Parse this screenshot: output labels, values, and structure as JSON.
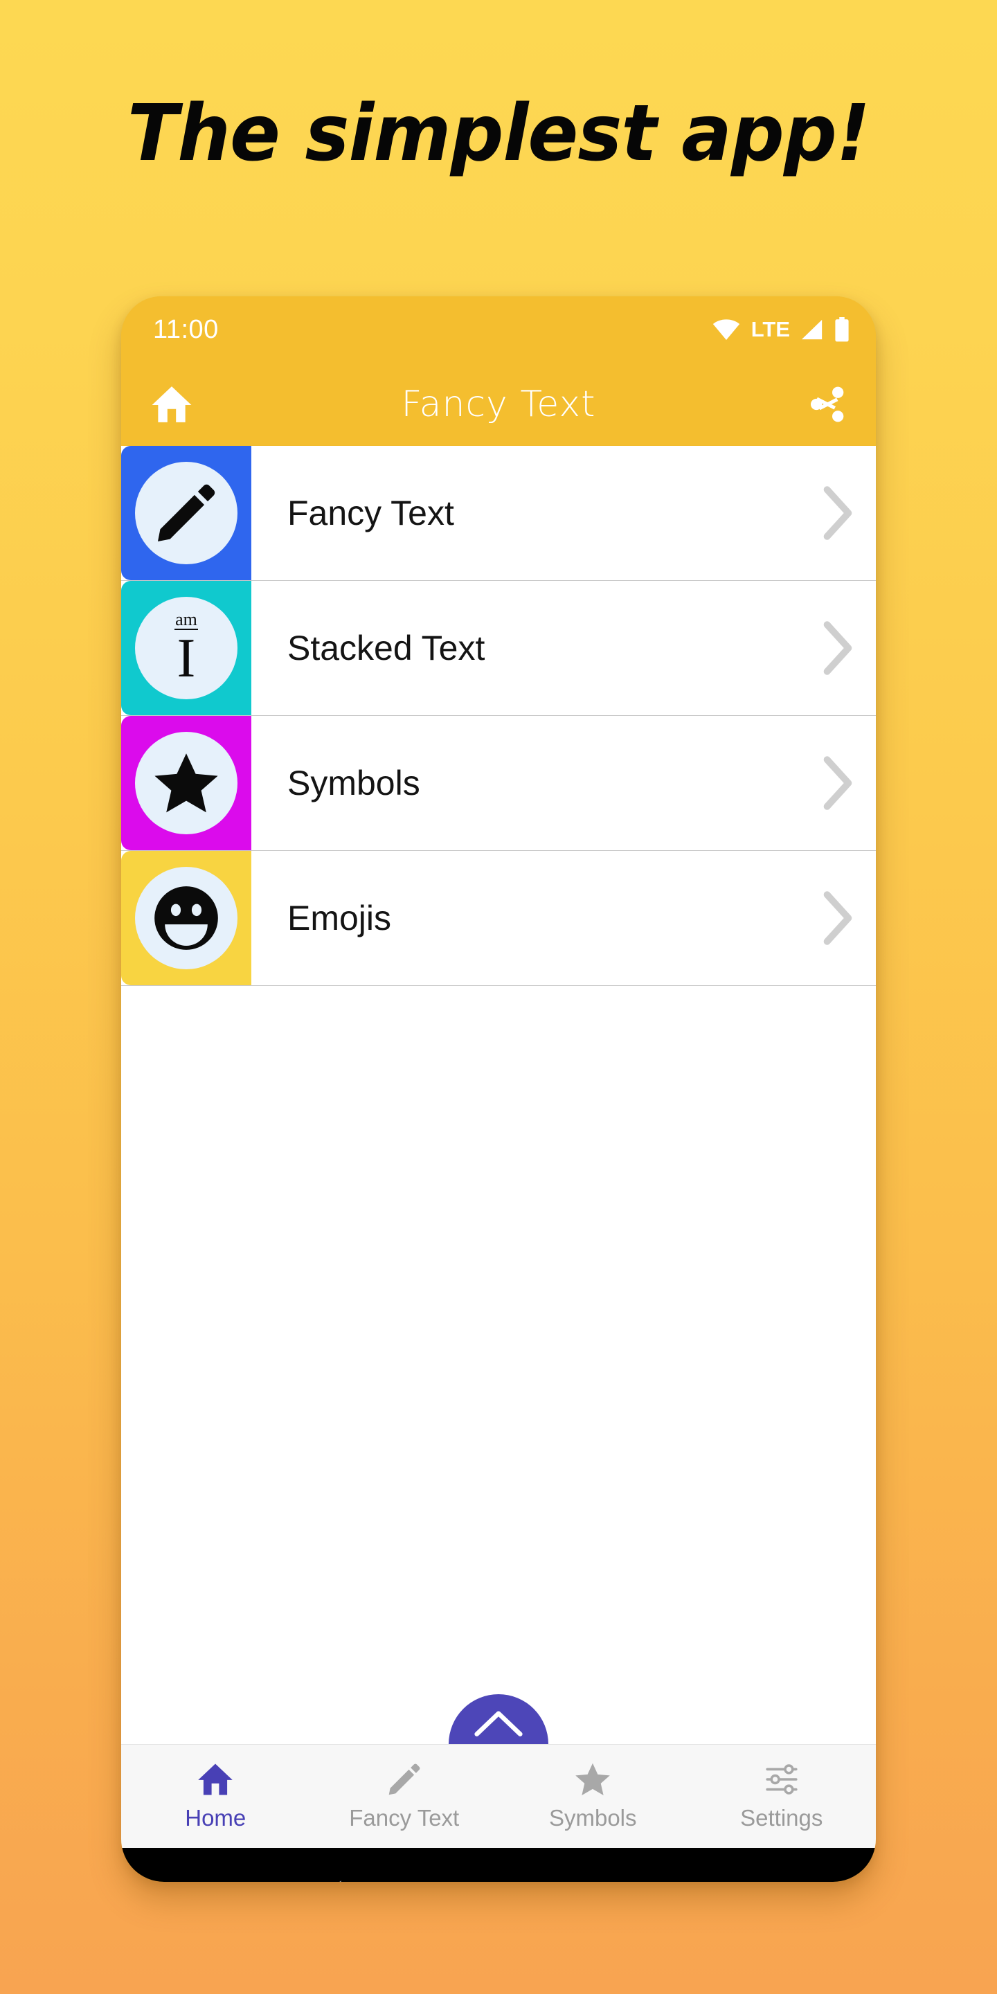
{
  "promo": {
    "headline": "The simplest app!",
    "bg_top": "#FDD852",
    "bg_bottom": "#F8A451"
  },
  "phone": {
    "statusbar": {
      "time": "11:00",
      "network_label": "LTE",
      "icons": [
        "wifi-icon",
        "signal-icon",
        "battery-icon"
      ]
    },
    "appbar": {
      "title": "Fancy Text",
      "left_icon": "home-icon",
      "right_icon": "share-icon",
      "bg": "#F4BE2F"
    },
    "list": [
      {
        "label": "Fancy Text",
        "icon": "pencil-icon",
        "tile_color": "#2F66EE",
        "disc_color": "#E6F1FB"
      },
      {
        "label": "Stacked Text",
        "icon": "stacked-text-icon",
        "tile_color": "#10C9CE",
        "disc_color": "#E6F1FB"
      },
      {
        "label": "Symbols",
        "icon": "star-icon",
        "tile_color": "#DB0BEC",
        "disc_color": "#E6F1FB"
      },
      {
        "label": "Emojis",
        "icon": "smiley-icon",
        "tile_color": "#F8D441",
        "disc_color": "#E6F1FB"
      }
    ],
    "stacked_icon_text": {
      "top": "am",
      "bottom": "I"
    },
    "fab": {
      "icon": "chevron-up-icon",
      "color": "#4D46B8"
    },
    "bottomnav": {
      "active_color": "#4840B5",
      "inactive_color": "#9A9A9A",
      "items": [
        {
          "label": "Home",
          "icon": "home-icon",
          "active": true
        },
        {
          "label": "Fancy Text",
          "icon": "pencil-icon",
          "active": false
        },
        {
          "label": "Symbols",
          "icon": "star-icon",
          "active": false
        },
        {
          "label": "Settings",
          "icon": "sliders-icon",
          "active": false
        }
      ]
    },
    "androidnav": {
      "back": "back-triangle-icon",
      "home": "home-circle-icon",
      "recents": "recents-square-icon"
    }
  }
}
